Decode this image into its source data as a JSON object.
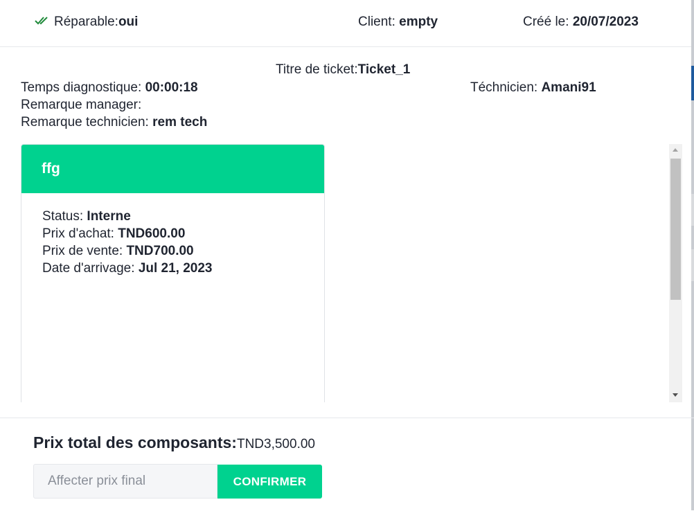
{
  "header": {
    "reparable_label": "Réparable:",
    "reparable_value": "oui",
    "client_label": "Client: ",
    "client_value": "empty",
    "created_label": "Créé le: ",
    "created_value": "20/07/2023"
  },
  "ticket": {
    "title_label": "Titre de ticket:",
    "title_value": "Ticket_1",
    "temps_label": "Temps diagnostique: ",
    "temps_value": "00:00:18",
    "technicien_label": "Téchnicien: ",
    "technicien_value": "Amani91",
    "remarque_manager_label": "Remarque manager:",
    "remarque_technicien_label": "Remarque technicien: ",
    "remarque_technicien_value": "rem tech"
  },
  "component_card": {
    "name": "ffg",
    "status_label": "Status: ",
    "status_value": "Interne",
    "prix_achat_label": "Prix d'achat: ",
    "prix_achat_value": "TND600.00",
    "prix_vente_label": "Prix de vente: ",
    "prix_vente_value": "TND700.00",
    "date_label": "Date d'arrivage: ",
    "date_value": "Jul 21, 2023"
  },
  "footer": {
    "total_label": "Prix total des composants:",
    "total_value": "TND3,500.00",
    "input_placeholder": "Affecter prix final",
    "confirm_label": "CONFIRMER"
  },
  "colors": {
    "accent": "#00d28f",
    "check": "#1f8a3a",
    "text": "#1f2430"
  },
  "icons": [
    "double-check-icon",
    "scroll-up-arrow-icon",
    "scroll-down-arrow-icon"
  ]
}
